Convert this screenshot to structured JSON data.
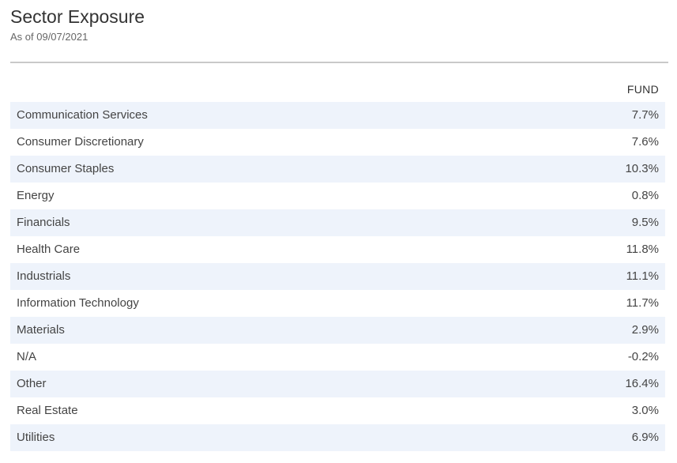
{
  "header": {
    "title": "Sector Exposure",
    "as_of": "As of 09/07/2021"
  },
  "table": {
    "column_header": "FUND",
    "rows": [
      {
        "sector": "Communication Services",
        "fund": "7.7%"
      },
      {
        "sector": "Consumer Discretionary",
        "fund": "7.6%"
      },
      {
        "sector": "Consumer Staples",
        "fund": "10.3%"
      },
      {
        "sector": "Energy",
        "fund": "0.8%"
      },
      {
        "sector": "Financials",
        "fund": "9.5%"
      },
      {
        "sector": "Health Care",
        "fund": "11.8%"
      },
      {
        "sector": "Industrials",
        "fund": "11.1%"
      },
      {
        "sector": "Information Technology",
        "fund": "11.7%"
      },
      {
        "sector": "Materials",
        "fund": "2.9%"
      },
      {
        "sector": "N/A",
        "fund": "-0.2%"
      },
      {
        "sector": "Other",
        "fund": "16.4%"
      },
      {
        "sector": "Real Estate",
        "fund": "3.0%"
      },
      {
        "sector": "Utilities",
        "fund": "6.9%"
      }
    ]
  },
  "colors": {
    "row_stripe": "#eef3fb",
    "divider": "#c9c9c9",
    "text": "#333333"
  }
}
